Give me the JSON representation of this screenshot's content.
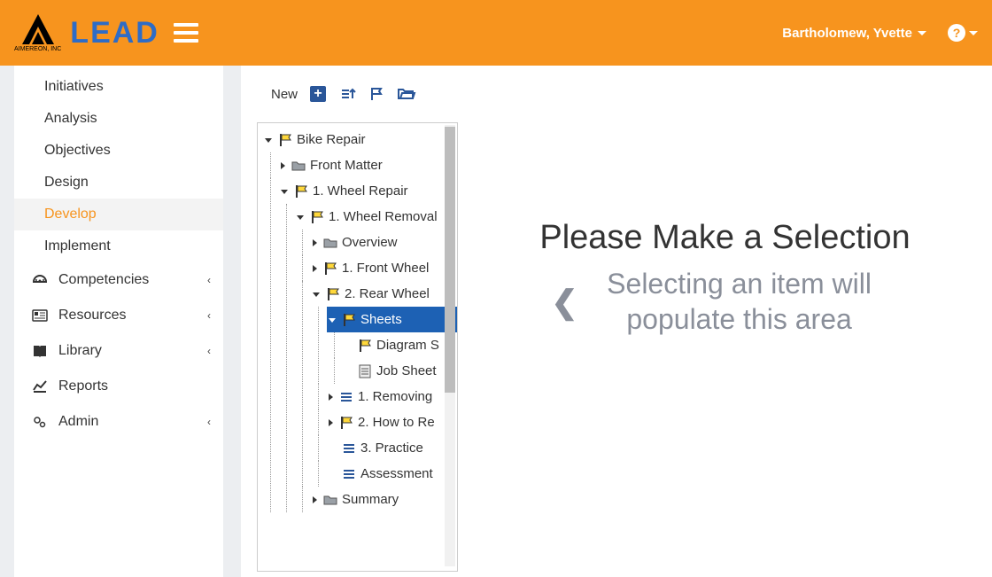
{
  "header": {
    "brand_small": "AIMEREON, INC",
    "brand": "LEAD",
    "user": "Bartholomew, Yvette",
    "help": "?"
  },
  "sidebar": {
    "sub": {
      "initiatives": "Initiatives",
      "analysis": "Analysis",
      "objectives": "Objectives",
      "design": "Design",
      "develop": "Develop",
      "implement": "Implement"
    },
    "nav": {
      "competencies": "Competencies",
      "resources": "Resources",
      "library": "Library",
      "reports": "Reports",
      "admin": "Admin"
    }
  },
  "toolbar": {
    "new": "New"
  },
  "tree": {
    "bike_repair": "Bike Repair",
    "front_matter": "Front Matter",
    "wheel_repair": "1. Wheel Repair",
    "wheel_removal": "1. Wheel Removal",
    "overview": "Overview",
    "front_wheel": "1. Front Wheel",
    "rear_wheel": "2. Rear Wheel",
    "sheets": "Sheets",
    "diagram_s": "Diagram S",
    "job_sheet": "Job Sheet",
    "removing": "1. Removing",
    "how_to_re": "2. How to Re",
    "practice": "3. Practice",
    "assessment": "Assessment",
    "summary": "Summary"
  },
  "message": {
    "title": "Please Make a Selection",
    "hint": "Selecting an item will populate this area"
  }
}
